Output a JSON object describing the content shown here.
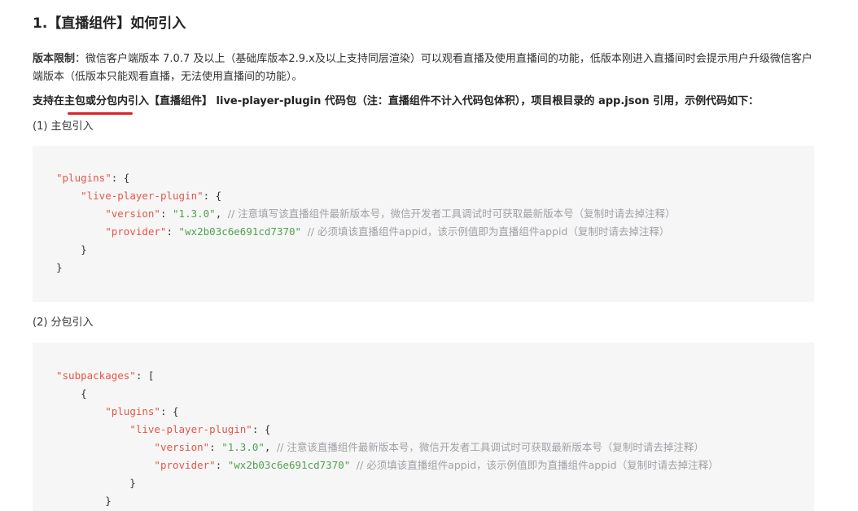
{
  "heading": "1.【直播组件】如何引入",
  "version_limit": {
    "label": "版本限制",
    "text": "：微信客户端版本 7.0.7 及以上（基础库版本2.9.x及以上支持同层渲染）可以观看直播及使用直播间的功能，低版本刚进入直播间时会提示用户升级微信客户端版本（低版本只能观看直播，无法使用直播间的功能）。"
  },
  "support_text": "支持在主包或分包内引入【直播组件】 live-player-plugin 代码包（注：直播组件不计入代码包体积），项目根目录的 app.json 引用，示例代码如下：",
  "accent_color": "#d8232a",
  "main_package": {
    "title": "(1) 主包引入",
    "plugins_key": "\"plugins\"",
    "plugin_key": "\"live-player-plugin\"",
    "version_key": "\"version\"",
    "version_value": "\"1.3.0\"",
    "version_comment": "// 注意填写该直播组件最新版本号，微信开发者工具调试时可获取最新版本号（复制时请去掉注释）",
    "provider_key": "\"provider\"",
    "provider_value": "\"wx2b03c6e691cd7370\"",
    "provider_comment": "// 必须填该直播组件appid，该示例值即为直播组件appid（复制时请去掉注释）"
  },
  "sub_package": {
    "title": "(2) 分包引入",
    "subpackages_key": "\"subpackages\"",
    "plugins_key": "\"plugins\"",
    "plugin_key": "\"live-player-plugin\"",
    "version_key": "\"version\"",
    "version_value": "\"1.3.0\"",
    "version_comment": "// 注意该直播组件最新版本号，微信开发者工具调试时可获取最新版本号（复制时请去掉注释）",
    "provider_key": "\"provider\"",
    "provider_value": "\"wx2b03c6e691cd7370\"",
    "provider_comment": "// 必须填该直播组件appid，该示例值即为直播组件appid（复制时请去掉注释）"
  }
}
